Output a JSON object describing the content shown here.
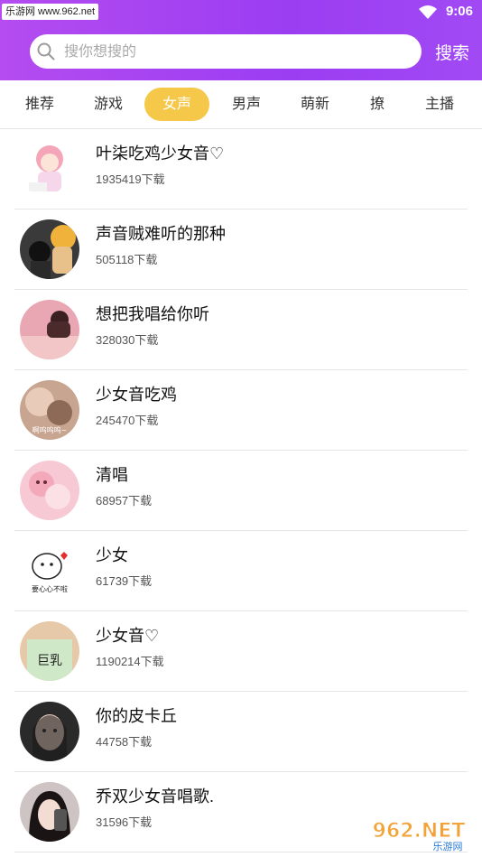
{
  "status": {
    "watermark": "乐游网 www.962.net",
    "time": "9:06"
  },
  "search": {
    "placeholder": "搜你想搜的",
    "button": "搜索"
  },
  "tabs": [
    "推荐",
    "游戏",
    "女声",
    "男声",
    "萌新",
    "撩",
    "主播"
  ],
  "active_tab": "女声",
  "items": [
    {
      "title": "叶柒吃鸡少女音♡",
      "downloads": "1935419下载"
    },
    {
      "title": "声音贼难听的那种",
      "downloads": "505118下载"
    },
    {
      "title": "想把我唱给你听",
      "downloads": "328030下载"
    },
    {
      "title": "少女音吃鸡",
      "downloads": "245470下载"
    },
    {
      "title": "清唱",
      "downloads": "68957下载"
    },
    {
      "title": "少女",
      "downloads": "61739下载"
    },
    {
      "title": "少女音♡",
      "downloads": "1190214下载"
    },
    {
      "title": "你的皮卡丘",
      "downloads": "44758下载"
    },
    {
      "title": "乔双少女音唱歌.",
      "downloads": "31596下载"
    }
  ],
  "avatar_texts": {
    "4": "啊呜呜呜~",
    "6": "要心心不啦",
    "7": "巨乳"
  },
  "brand_watermark": {
    "big": "962.NET",
    "small": "乐游网"
  },
  "colors": {
    "header_start": "#b44cf0",
    "header_end": "#a14af4",
    "active_tab": "#f5c84a"
  }
}
